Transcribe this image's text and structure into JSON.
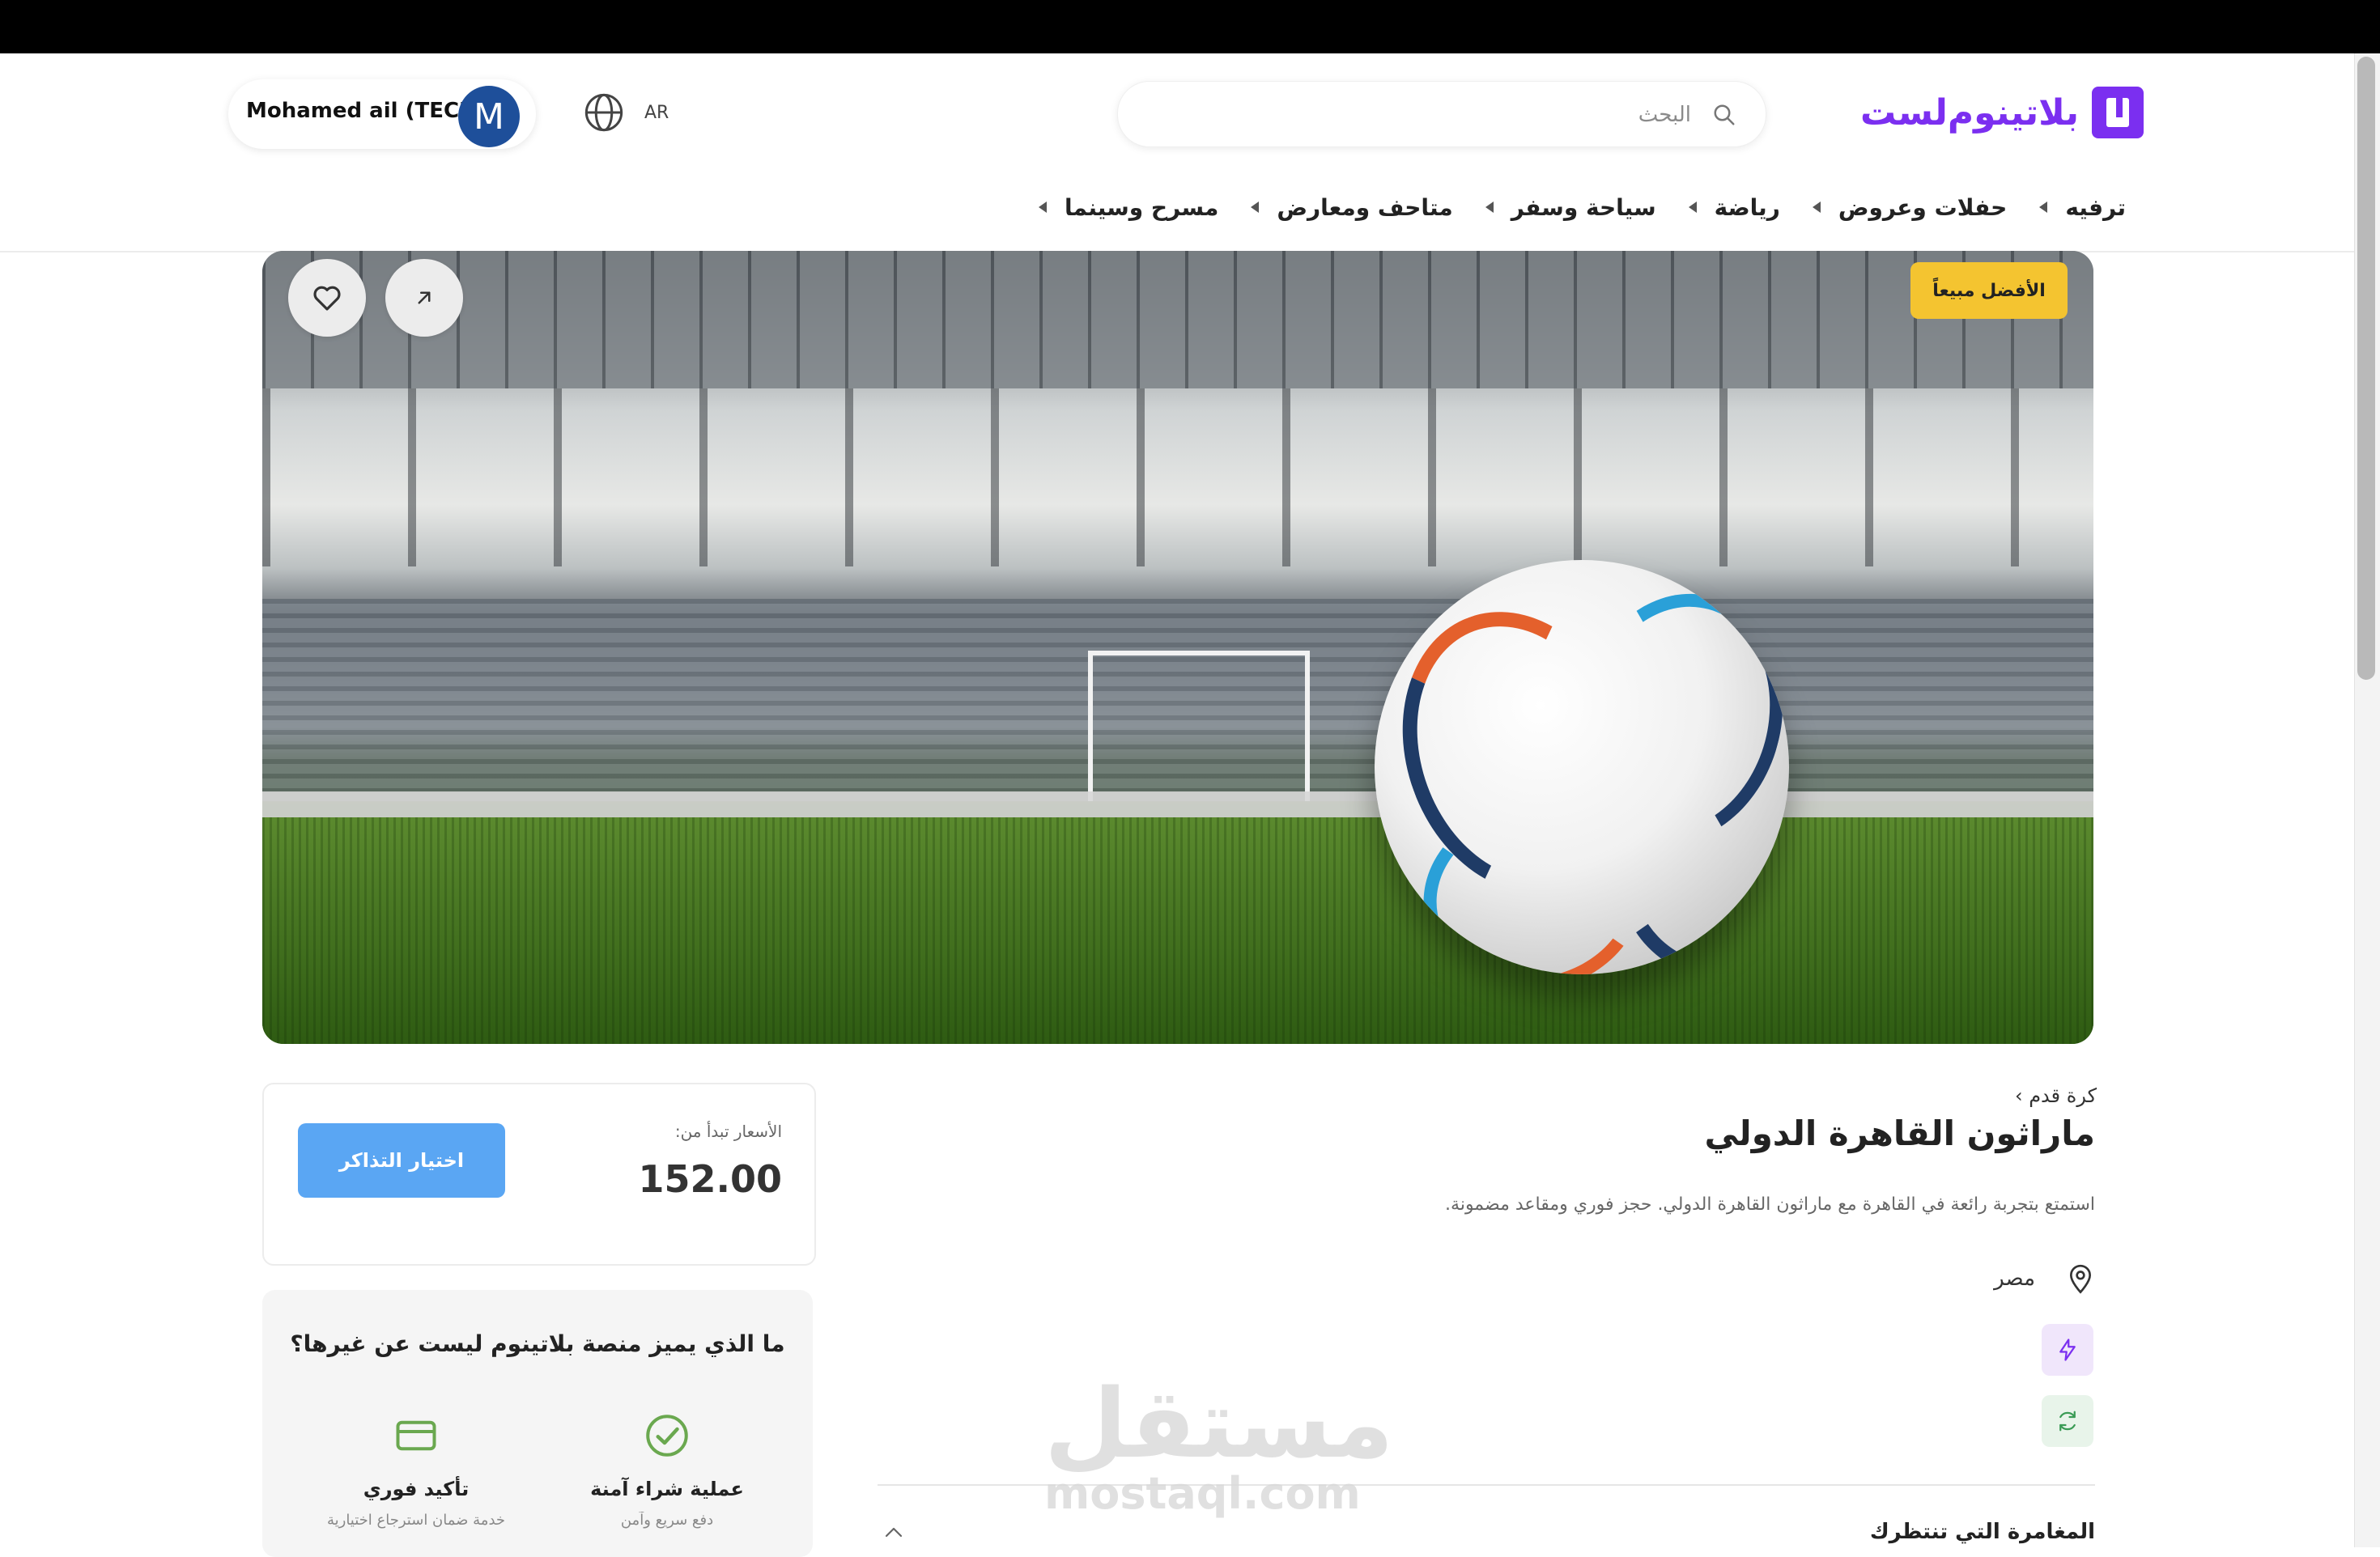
{
  "header": {
    "logo_text": "بلاتينوم‌لست",
    "search_placeholder": "البحث",
    "lang_label": "AR",
    "user_name": "Mohamed ail (TECH)",
    "avatar_initial": "M"
  },
  "nav": {
    "items": [
      {
        "label": "ترفيه"
      },
      {
        "label": "حفلات وعروض"
      },
      {
        "label": "رياضة"
      },
      {
        "label": "سياحة وسفر"
      },
      {
        "label": "متاحف ومعارض"
      },
      {
        "label": "مسرح وسينما"
      }
    ]
  },
  "hero": {
    "badge": "الأفضل مبيعاً",
    "icons": {
      "share": "share-arrow-icon",
      "favorite": "heart-icon"
    }
  },
  "event": {
    "breadcrumb": "كرة قدم ›",
    "title": "ماراثون القاهرة الدولي",
    "description": "استمتع بتجربة رائعة في القاهرة مع ماراثون القاهرة الدولي. حجز فوري ومقاعد مضمونة.",
    "location": "مصر",
    "section_title": "المغامرة التي تنتظرك"
  },
  "price": {
    "label": "الأسعار تبدأ من:",
    "value": "152.00",
    "button": "اختيار التذاكر"
  },
  "why": {
    "title": "ما الذي يميز منصة بلاتينوم ليست عن غيرها؟",
    "items": [
      {
        "label": "عملية شراء آمنة",
        "sub": "دفع سريع وآمن"
      },
      {
        "label": "تأكيد فوري",
        "sub": "خدمة ضمان استرجاع اختيارية"
      }
    ]
  },
  "watermark": {
    "ar": "مستقل",
    "en": "mostaql.com"
  },
  "colors": {
    "brand": "#7b2ff0",
    "button_blue": "#5aa6f3",
    "badge_yellow": "#f4c430",
    "success_green": "#6aa84f"
  }
}
